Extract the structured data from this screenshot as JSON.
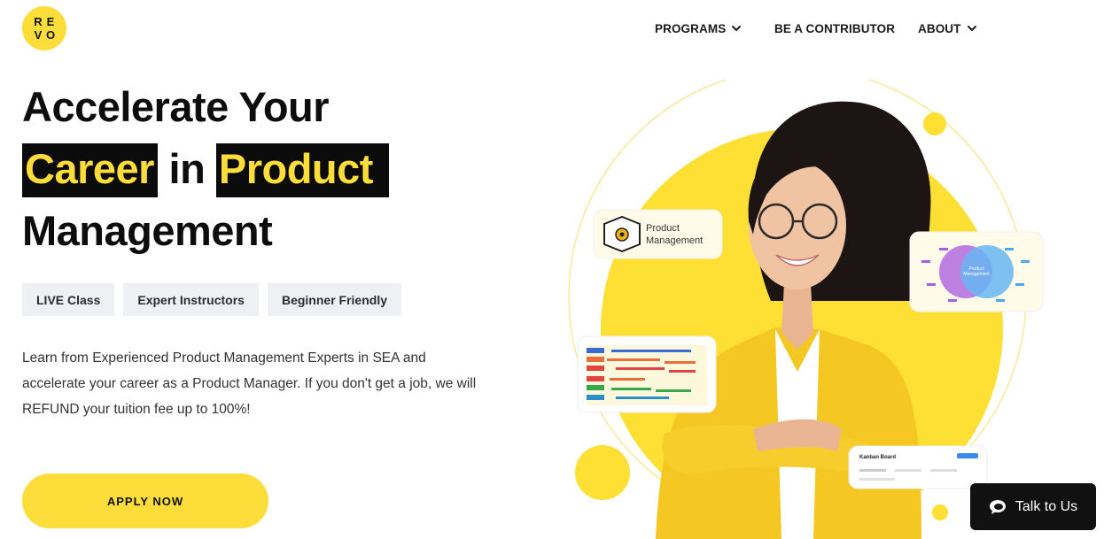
{
  "logo": {
    "letters": [
      "R",
      "E",
      "V",
      "O"
    ]
  },
  "nav": {
    "programs": "PROGRAMS",
    "contributor": "BE A CONTRIBUTOR",
    "about": "ABOUT"
  },
  "headline": {
    "line1": "Accelerate Your",
    "career": "Career",
    "in": "in",
    "product": "Product",
    "line3": "Management"
  },
  "tags": [
    "LIVE Class",
    "Expert Instructors",
    "Beginner Friendly"
  ],
  "description": "Learn from Experienced Product Management Experts in SEA and accelerate your career as a Product Manager. If you don't get a job, we will REFUND your tuition fee up to 100%!",
  "cta": {
    "apply": "APPLY NOW"
  },
  "cards": {
    "product_management_line1": "Product",
    "product_management_line2": "Management",
    "venn_center_line1": "Product",
    "venn_center_line2": "Management",
    "kanban_title": "Kanban Board"
  },
  "chat": {
    "label": "Talk to Us"
  },
  "colors": {
    "accent": "#fddd3a",
    "dark": "#0b0b0b",
    "tag_bg": "#eef0f4"
  }
}
